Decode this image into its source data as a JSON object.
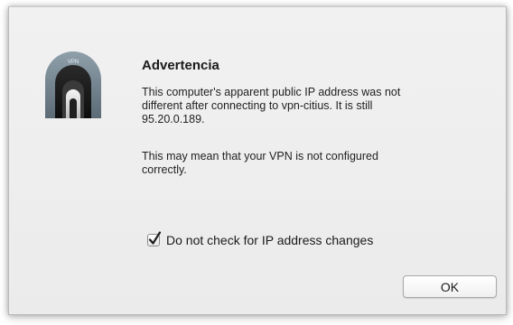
{
  "dialog": {
    "app_icon": "vpn-tunnel-icon",
    "app_icon_label": "VPN",
    "title": "Advertencia",
    "message_1": "This computer's apparent public IP address was not\ndifferent after connecting to vpn-citius. It is still\n95.20.0.189.",
    "message_2": "This may mean that your VPN is not configured\ncorrectly.",
    "checkbox": {
      "label": "Do not check for IP address changes",
      "checked": true,
      "icon": "checkmark-icon"
    },
    "ok_label": "OK"
  },
  "colors": {
    "dialog_background": "#ececec",
    "tunnel_arch": "#6f7f8a",
    "tunnel_inner": "#1c1c1c"
  }
}
